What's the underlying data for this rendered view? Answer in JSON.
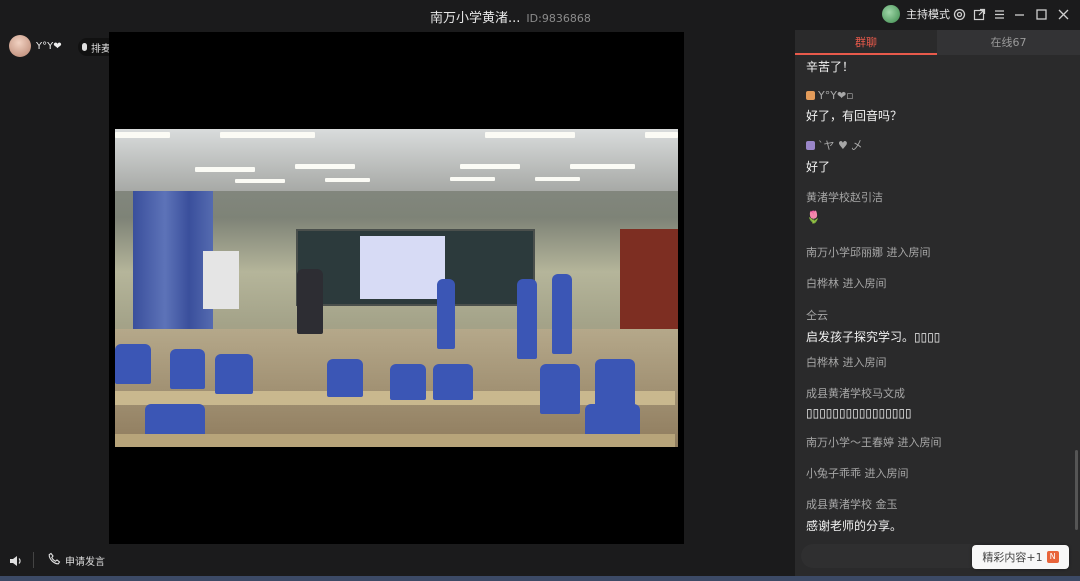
{
  "window": {
    "title": "南万小学黄渚...",
    "room_id": "ID:9836868",
    "host_mode_label": "主持模式"
  },
  "user": {
    "name": "Y°Y❤",
    "rank_label": "排麦"
  },
  "footer": {
    "apply_speak_label": "申请发言"
  },
  "panel": {
    "tabs": [
      {
        "label": "群聊",
        "active": true
      },
      {
        "label": "在线67",
        "active": false
      }
    ],
    "messages": [
      {
        "sender": "",
        "text": "辛苦了！"
      },
      {
        "sender": "Y°Y❤▫",
        "text": "好了，有回音吗？"
      },
      {
        "sender": "`ヤ ♥ 乄",
        "text": "好了"
      },
      {
        "sender": "黄渚学校赵引洁",
        "text": "🌷"
      },
      {
        "sender": "南万小学邱丽娜 进入房间",
        "text": ""
      },
      {
        "sender": "白桦林 进入房间",
        "text": ""
      },
      {
        "sender": "仝云",
        "text": "启发孩子探究学习。▯▯▯▯"
      },
      {
        "sender": "白桦林 进入房间",
        "text": ""
      },
      {
        "sender": "成县黄渚学校马文成",
        "text": "▯▯▯▯▯▯▯▯▯▯▯▯▯▯▯▯"
      },
      {
        "sender": "南万小学～王春婷 进入房间",
        "text": ""
      },
      {
        "sender": "小兔子乖乖 进入房间",
        "text": ""
      },
      {
        "sender": "成县黄渚学校  金玉",
        "text": "感谢老师的分享。"
      }
    ],
    "popup_label": "精彩内容+1",
    "popup_badge": "N"
  },
  "colors": {
    "accent": "#e85a4b",
    "panel_bg": "#2a2a2b",
    "app_bg": "#1b1b1c"
  }
}
